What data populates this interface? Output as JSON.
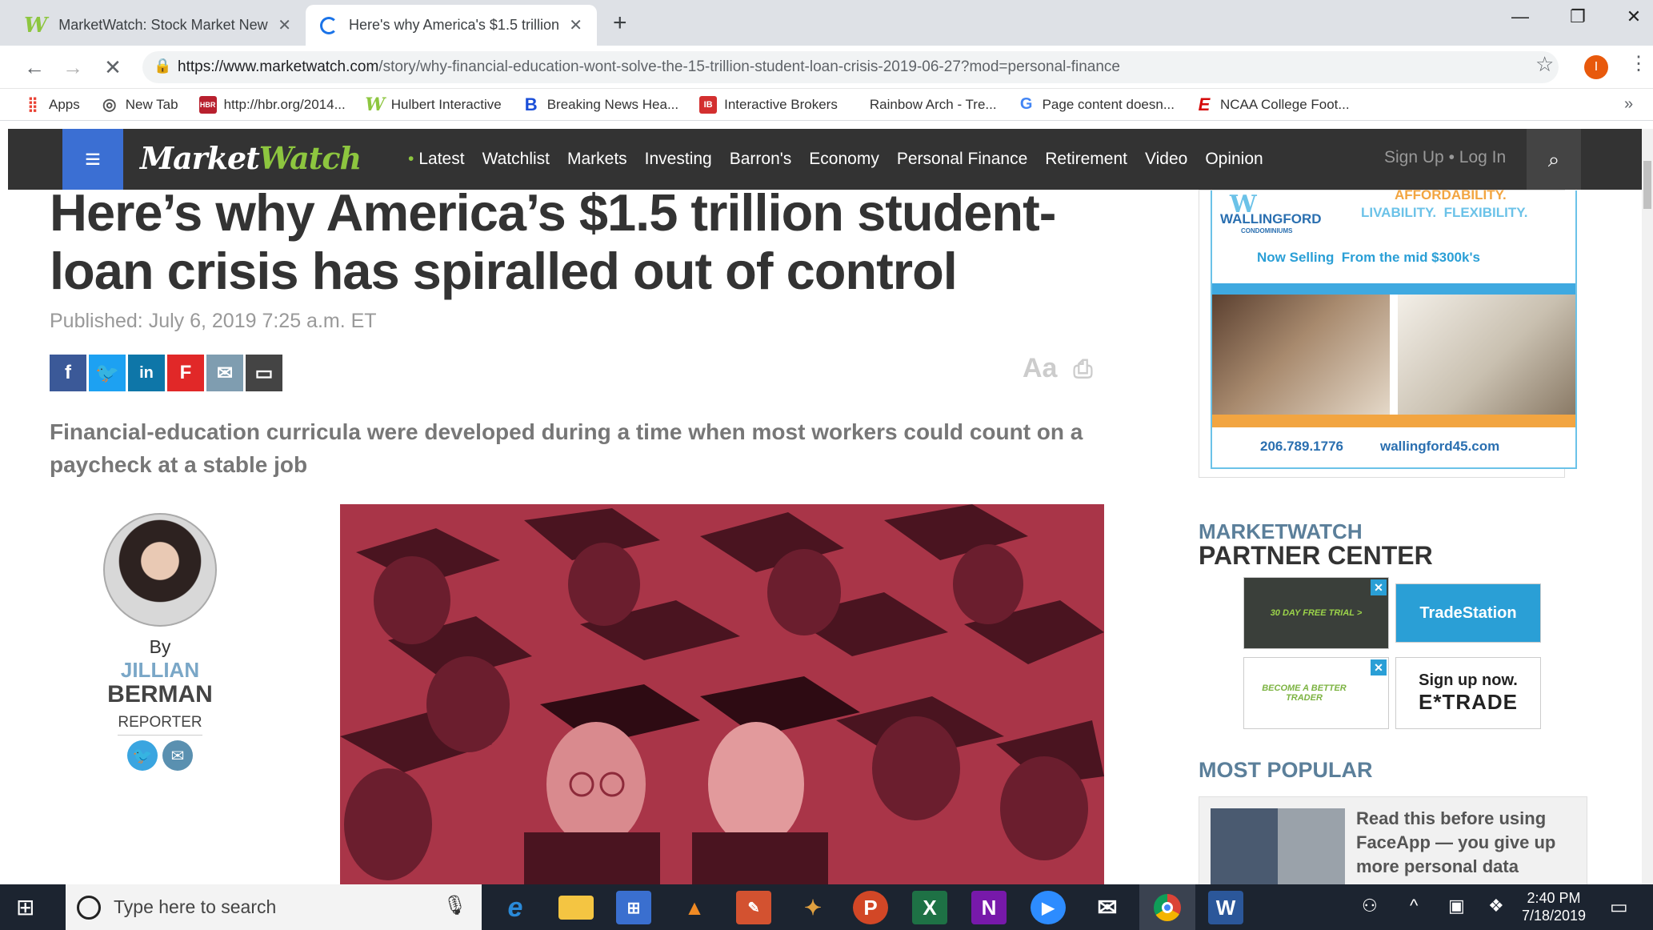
{
  "browser": {
    "tabs": [
      {
        "title": "MarketWatch: Stock Market New",
        "favicon": "W"
      },
      {
        "title": "Here's why America's $1.5 trillion",
        "favicon": "loading"
      }
    ],
    "url_host": "https://www.marketwatch.com",
    "url_path": "/story/why-financial-education-wont-solve-the-15-trillion-student-loan-crisis-2019-06-27?mod=personal-finance",
    "profile_initial": "I",
    "bookmarks": [
      {
        "label": "Apps",
        "icon": "apps-grid"
      },
      {
        "label": "New Tab",
        "icon": "globe"
      },
      {
        "label": "http://hbr.org/2014...",
        "icon": "HBR"
      },
      {
        "label": "Hulbert Interactive",
        "icon": "W"
      },
      {
        "label": "Breaking News Hea...",
        "icon": "B"
      },
      {
        "label": "Interactive Brokers",
        "icon": "IB"
      },
      {
        "label": "Rainbow Arch - Tre...",
        "icon": "none"
      },
      {
        "label": "Page content doesn...",
        "icon": "G"
      },
      {
        "label": "NCAA College Foot...",
        "icon": "E"
      }
    ]
  },
  "site": {
    "logo_a": "Market",
    "logo_b": "Watch",
    "nav": [
      "Latest",
      "Watchlist",
      "Markets",
      "Investing",
      "Barron's",
      "Economy",
      "Personal Finance",
      "Retirement",
      "Video",
      "Opinion"
    ],
    "sign_up": "Sign Up",
    "separator": "•",
    "log_in": "Log In"
  },
  "article": {
    "headline": "Here’s why America’s $1.5 trillion student-loan crisis has spiralled out of control",
    "published": "Published: July 6, 2019 7:25 a.m. ET",
    "text_size_label": "Aa",
    "dek": "Financial-education curricula were developed during a time when most workers could count on a paycheck at a stable job",
    "author": {
      "by": "By",
      "first": "JILLIAN",
      "last": "BERMAN",
      "role": "REPORTER"
    }
  },
  "ad": {
    "brand": "WALLINGFORD",
    "brand_sub": "CONDOMINIUMS",
    "tag1": "AFFORDABILITY.",
    "tag2": "LIVABILITY.  FLEXIBILITY.",
    "selling": "Now Selling  From the mid $300k's",
    "phone": "206.789.1776",
    "site": "wallingford45.com"
  },
  "partner": {
    "heading_small": "MARKETWATCH",
    "heading_big": "PARTNER CENTER",
    "trial": "30 DAY FREE TRIAL >",
    "tradestation": "TradeStation",
    "better_trader": "BECOME A BETTER TRADER",
    "signup": "Sign up now.",
    "etrade": "E*TRADE"
  },
  "most_popular": {
    "heading": "MOST POPULAR",
    "first_title": "Read this before using FaceApp — you give up more personal data"
  },
  "taskbar": {
    "search_placeholder": "Type here to search",
    "time": "2:40 PM",
    "date": "7/18/2019"
  },
  "colors": {
    "mw_nav": "#333333",
    "mw_accent": "#8dc63f",
    "menu_blue": "#3b6fd3",
    "facebook": "#3b5998",
    "twitter": "#1da1f2",
    "linkedin": "#0e76a8",
    "flipboard": "#e12828",
    "email": "#7f9db0",
    "comment": "#444444"
  }
}
